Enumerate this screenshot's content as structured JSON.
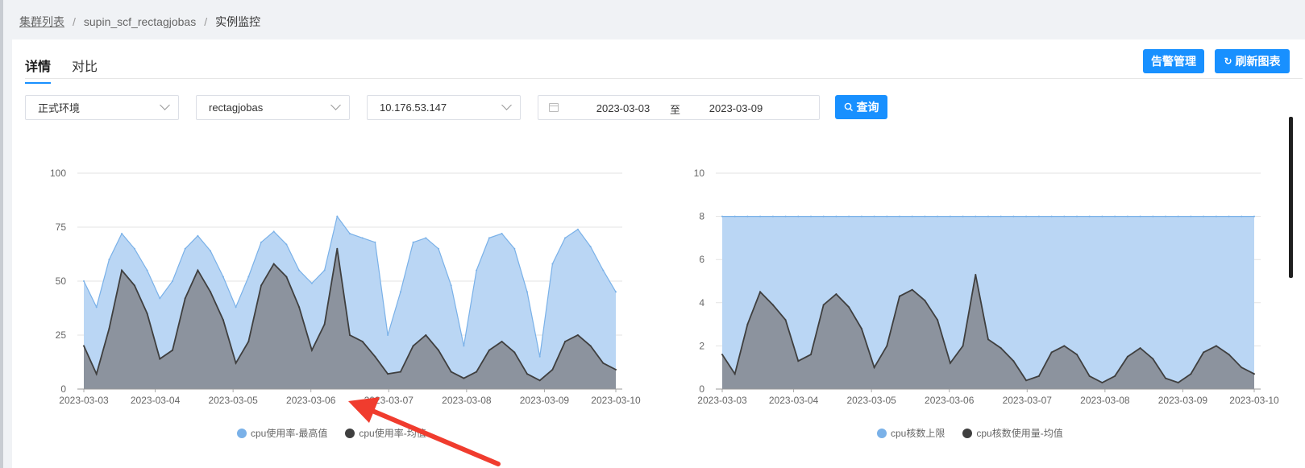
{
  "breadcrumb": {
    "item1": "集群列表",
    "sep": "/",
    "item2": "supin_scf_rectagjobas",
    "item3": "实例监控"
  },
  "tabs": {
    "detail": "详情",
    "compare": "对比"
  },
  "buttons": {
    "alert": "告警管理",
    "refresh": "刷新图表",
    "query": "查询"
  },
  "filters": {
    "env": "正式环境",
    "cluster": "rectagjobas",
    "ip": "10.176.53.147"
  },
  "daterange": {
    "start": "2023-03-03",
    "sep": "至",
    "end": "2023-03-09"
  },
  "colors": {
    "accent": "#1890ff",
    "series_max": "#7ab1e8",
    "series_avg": "#3f3f3f",
    "area_max_light": "#b6d4f3",
    "area_avg": "#84878e",
    "annotation_arrow": "#f03c2e"
  },
  "icons": {
    "refresh": "refresh-icon",
    "search": "search-icon",
    "calendar": "calendar-icon",
    "chevron": "chevron-down-icon"
  },
  "chart_data": [
    {
      "type": "area",
      "title": "",
      "xlabel": "",
      "ylabel": "",
      "ylim": [
        0,
        100
      ],
      "yticks": [
        "0",
        "25",
        "50",
        "75",
        "100"
      ],
      "xticks": [
        "2023-03-03",
        "2023-03-04",
        "2023-03-05",
        "2023-03-06",
        "2023-03-07",
        "2023-03-08",
        "2023-03-09",
        "2023-03-10"
      ],
      "x": [
        "03-03 00:00",
        "03-03 04:00",
        "03-03 08:00",
        "03-03 12:00",
        "03-03 16:00",
        "03-03 20:00",
        "03-04 00:00",
        "03-04 04:00",
        "03-04 08:00",
        "03-04 12:00",
        "03-04 16:00",
        "03-04 20:00",
        "03-05 00:00",
        "03-05 04:00",
        "03-05 08:00",
        "03-05 12:00",
        "03-05 16:00",
        "03-05 20:00",
        "03-06 00:00",
        "03-06 04:00",
        "03-06 08:00",
        "03-06 12:00",
        "03-06 16:00",
        "03-06 20:00",
        "03-07 00:00",
        "03-07 04:00",
        "03-07 08:00",
        "03-07 12:00",
        "03-07 16:00",
        "03-07 20:00",
        "03-08 00:00",
        "03-08 04:00",
        "03-08 08:00",
        "03-08 12:00",
        "03-08 16:00",
        "03-08 20:00",
        "03-09 00:00",
        "03-09 04:00",
        "03-09 08:00",
        "03-09 12:00",
        "03-09 16:00",
        "03-09 20:00",
        "03-10 00:00"
      ],
      "series": [
        {
          "name": "cpu使用率-最高值",
          "values": [
            50,
            38,
            60,
            72,
            65,
            55,
            42,
            50,
            65,
            71,
            64,
            52,
            38,
            52,
            68,
            73,
            67,
            55,
            49,
            55,
            80,
            72,
            70,
            68,
            25,
            45,
            68,
            70,
            65,
            48,
            20,
            55,
            70,
            72,
            65,
            45,
            15,
            58,
            70,
            74,
            66,
            55,
            45
          ]
        },
        {
          "name": "cpu使用率-均值",
          "values": [
            20,
            7,
            28,
            55,
            48,
            35,
            14,
            18,
            42,
            55,
            45,
            32,
            12,
            22,
            48,
            58,
            52,
            38,
            18,
            30,
            65,
            25,
            22,
            15,
            7,
            8,
            20,
            25,
            18,
            8,
            5,
            8,
            18,
            22,
            17,
            7,
            4,
            9,
            22,
            25,
            20,
            12,
            9
          ]
        }
      ]
    },
    {
      "type": "area",
      "title": "",
      "xlabel": "",
      "ylabel": "",
      "ylim": [
        0,
        10
      ],
      "yticks": [
        "0",
        "2",
        "4",
        "6",
        "8",
        "10"
      ],
      "xticks": [
        "2023-03-03",
        "2023-03-04",
        "2023-03-05",
        "2023-03-06",
        "2023-03-07",
        "2023-03-08",
        "2023-03-09",
        "2023-03-10"
      ],
      "x": [
        "03-03 00:00",
        "03-03 04:00",
        "03-03 08:00",
        "03-03 12:00",
        "03-03 16:00",
        "03-03 20:00",
        "03-04 00:00",
        "03-04 04:00",
        "03-04 08:00",
        "03-04 12:00",
        "03-04 16:00",
        "03-04 20:00",
        "03-05 00:00",
        "03-05 04:00",
        "03-05 08:00",
        "03-05 12:00",
        "03-05 16:00",
        "03-05 20:00",
        "03-06 00:00",
        "03-06 04:00",
        "03-06 08:00",
        "03-06 12:00",
        "03-06 16:00",
        "03-06 20:00",
        "03-07 00:00",
        "03-07 04:00",
        "03-07 08:00",
        "03-07 12:00",
        "03-07 16:00",
        "03-07 20:00",
        "03-08 00:00",
        "03-08 04:00",
        "03-08 08:00",
        "03-08 12:00",
        "03-08 16:00",
        "03-08 20:00",
        "03-09 00:00",
        "03-09 04:00",
        "03-09 08:00",
        "03-09 12:00",
        "03-09 16:00",
        "03-09 20:00",
        "03-10 00:00"
      ],
      "series": [
        {
          "name": "cpu核数上限",
          "values": [
            8,
            8,
            8,
            8,
            8,
            8,
            8,
            8,
            8,
            8,
            8,
            8,
            8,
            8,
            8,
            8,
            8,
            8,
            8,
            8,
            8,
            8,
            8,
            8,
            8,
            8,
            8,
            8,
            8,
            8,
            8,
            8,
            8,
            8,
            8,
            8,
            8,
            8,
            8,
            8,
            8,
            8,
            8
          ]
        },
        {
          "name": "cpu核数使用量-均值",
          "values": [
            1.6,
            0.7,
            3.0,
            4.5,
            3.9,
            3.2,
            1.3,
            1.6,
            3.9,
            4.4,
            3.8,
            2.8,
            1.0,
            2.0,
            4.3,
            4.6,
            4.1,
            3.2,
            1.2,
            2.0,
            5.3,
            2.3,
            1.9,
            1.3,
            0.4,
            0.6,
            1.7,
            2.0,
            1.6,
            0.6,
            0.3,
            0.6,
            1.5,
            1.9,
            1.4,
            0.5,
            0.3,
            0.7,
            1.7,
            2.0,
            1.6,
            1.0,
            0.7
          ]
        }
      ]
    }
  ]
}
